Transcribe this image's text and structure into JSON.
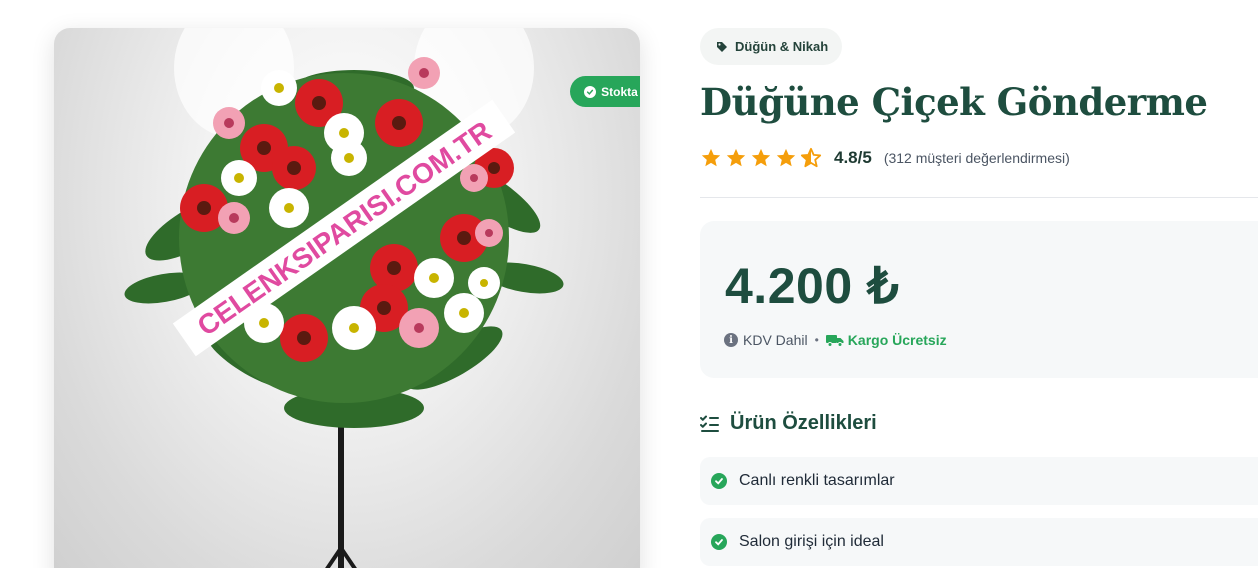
{
  "product": {
    "image_banner_text": "CELENKSIPARISI.COM.TR",
    "stock_badge": "Stokta Var",
    "category": "Düğün & Nikah",
    "title": "Düğüne Çiçek Gönderme",
    "rating": {
      "stars": 4.5,
      "value": "4.8/5",
      "count_text": "(312 müşteri değerlendirmesi)"
    },
    "price": "4.200 ₺",
    "tax_text": "KDV Dahil",
    "shipping_text": "Kargo Ücretsiz",
    "features_heading": "Ürün Özellikleri",
    "features": [
      "Canlı renkli tasarımlar",
      "Salon girişi için ideal"
    ]
  },
  "colors": {
    "brand_green": "#1e4d3f",
    "success_green": "#27a65a",
    "star_orange": "#f59e0b"
  },
  "icons": {
    "category": "tag-icon",
    "stock": "check-circle-icon",
    "tax": "info-icon",
    "shipping": "truck-icon",
    "features": "list-check-icon",
    "feature_item": "check-circle-icon"
  }
}
